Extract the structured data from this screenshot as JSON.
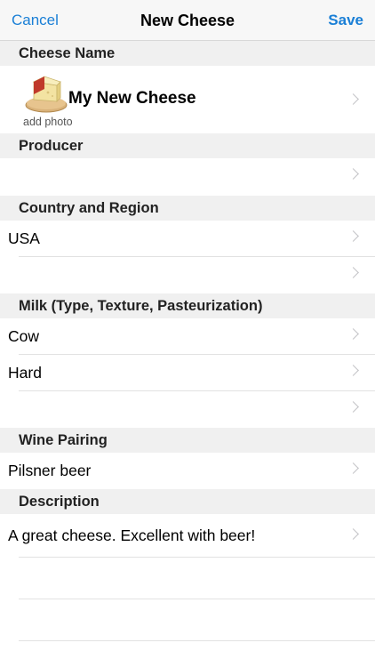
{
  "nav": {
    "cancel": "Cancel",
    "title": "New Cheese",
    "save": "Save"
  },
  "sections": {
    "cheese_name": {
      "header": "Cheese Name",
      "name": "My New Cheese",
      "photo_label": "add photo",
      "photo_icon": "cheese-wedge-icon"
    },
    "producer": {
      "header": "Producer",
      "rows": [
        ""
      ]
    },
    "country_region": {
      "header": "Country and Region",
      "rows": [
        "USA",
        ""
      ]
    },
    "milk": {
      "header": "Milk (Type, Texture, Pasteurization)",
      "rows": [
        "Cow",
        "Hard",
        ""
      ]
    },
    "wine_pairing": {
      "header": "Wine Pairing",
      "rows": [
        "Pilsner beer"
      ]
    },
    "description": {
      "header": "Description",
      "rows": [
        "A great cheese.  Excellent with beer!",
        "",
        ""
      ]
    }
  },
  "colors": {
    "accent": "#1a7fd6",
    "section_bg": "#f0f0f0",
    "chevron": "#c4c4c7"
  },
  "icons": {
    "chevron": "chevron-right-icon"
  }
}
